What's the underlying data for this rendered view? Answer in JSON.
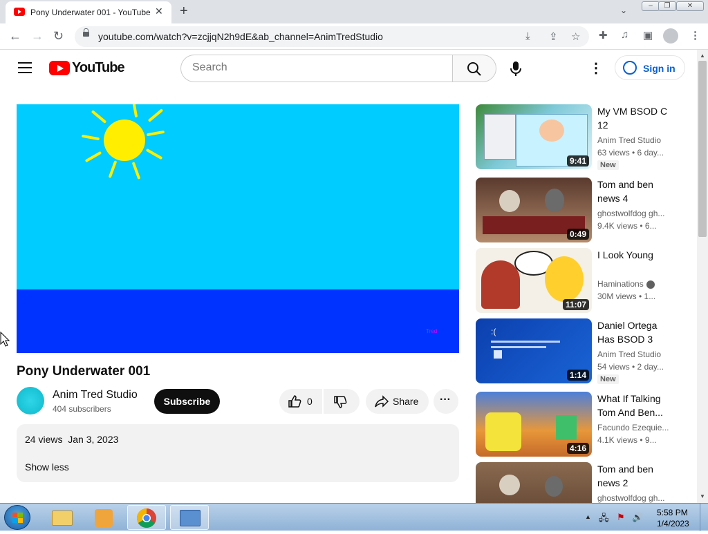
{
  "browser": {
    "tab_title": "Pony Underwater 001 - YouTube",
    "url": "youtube.com/watch?v=zcjjqN2h9dE&ab_channel=AnimTredStudio"
  },
  "youtube": {
    "logo_text": "YouTube",
    "search_placeholder": "Search",
    "signin_label": "Sign in",
    "brand_color": "#ff0000"
  },
  "video": {
    "title": "Pony Underwater 001",
    "watermark": "Tred",
    "channel_name": "Anim Tred Studio",
    "subscribers": "404 subscribers",
    "subscribe_label": "Subscribe",
    "likes": "0",
    "share_label": "Share",
    "description_meta": "24 views  Jan 3, 2023",
    "show_less": "Show less"
  },
  "recommendations": [
    {
      "title": "My VM BSOD C 12",
      "channel": "Anim Tred Studio",
      "views": "63 views • 6 day...",
      "duration": "9:41",
      "badge": "New"
    },
    {
      "title": "Tom and ben news 4",
      "channel": "ghostwolfdog gh...",
      "views": "9.4K views • 6...",
      "duration": "0:49"
    },
    {
      "title": "I Look Young",
      "channel": "Haminations",
      "views": "30M views • 1...",
      "duration": "11:07",
      "verified": true
    },
    {
      "title": "Daniel Ortega Has BSOD 3",
      "channel": "Anim Tred Studio",
      "views": "54 views • 2 day...",
      "duration": "1:14",
      "badge": "New"
    },
    {
      "title": "What If Talking Tom And Ben...",
      "channel": "Facundo Ezequie...",
      "views": "4.1K views • 9...",
      "duration": "4:16"
    },
    {
      "title": "Tom and ben news 2",
      "channel": "ghostwolfdog gh..."
    }
  ],
  "taskbar": {
    "time": "5:58 PM",
    "date": "1/4/2023"
  }
}
